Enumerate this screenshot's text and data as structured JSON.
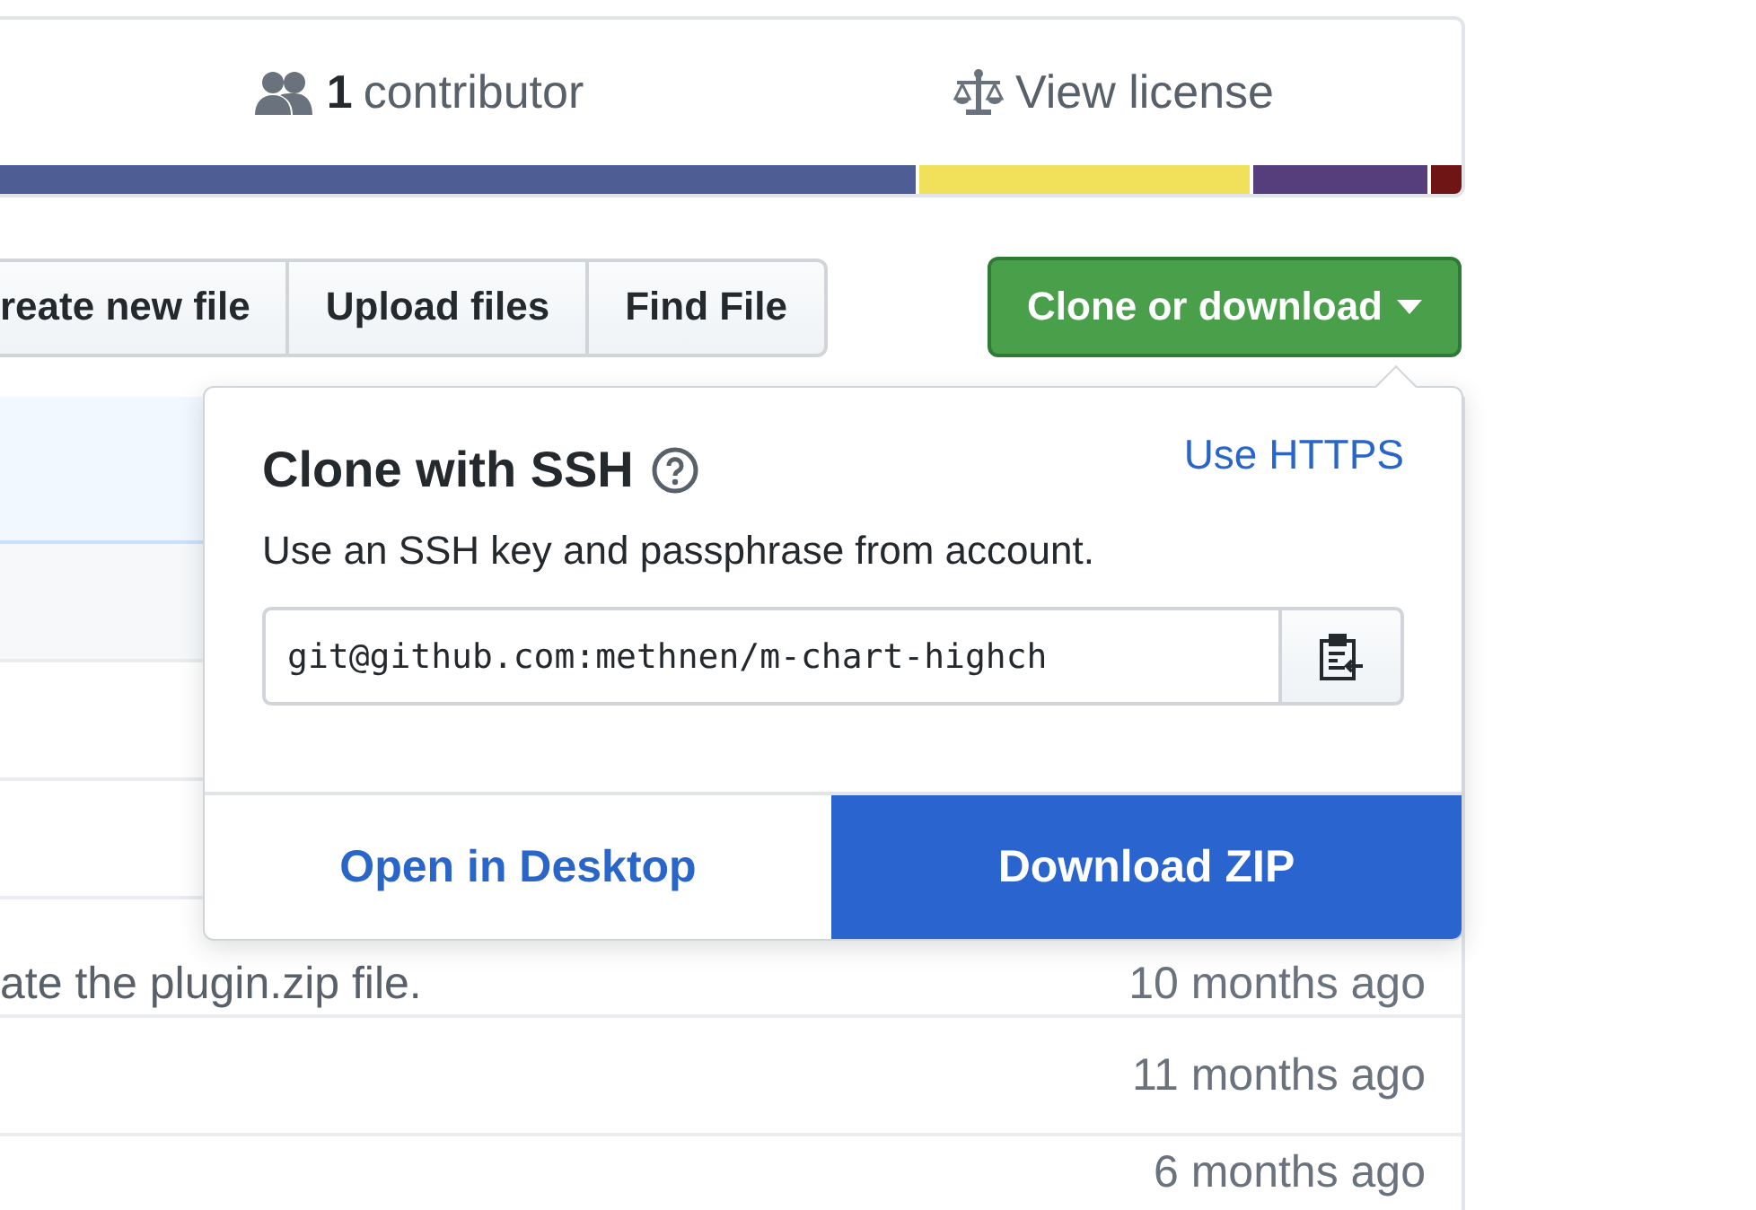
{
  "summary": {
    "contributors_count": "1",
    "contributors_label": "contributor",
    "license": "View license"
  },
  "file_buttons": [
    "reate new file",
    "Upload files",
    "Find File"
  ],
  "clone_button": {
    "label": "Clone or download",
    "expanded": true
  },
  "clone_popover": {
    "title": "Clone with SSH",
    "switch_link": "Use HTTPS",
    "description": "Use an SSH key and passphrase from account.",
    "url": "git@github.com:methnen/m-chart-highch",
    "open_desktop": "Open in Desktop",
    "download_zip": "Download ZIP"
  },
  "rows": [
    {
      "highlighted": true
    },
    {
      "highlighted": false
    },
    {
      "highlighted": false
    },
    {
      "highlighted": false
    },
    {
      "message": "ate the plugin.zip file.",
      "age": "10 months ago",
      "highlighted": false
    },
    {
      "age": "11 months ago",
      "highlighted": false
    },
    {
      "age": "6 months ago",
      "highlighted": false
    }
  ]
}
